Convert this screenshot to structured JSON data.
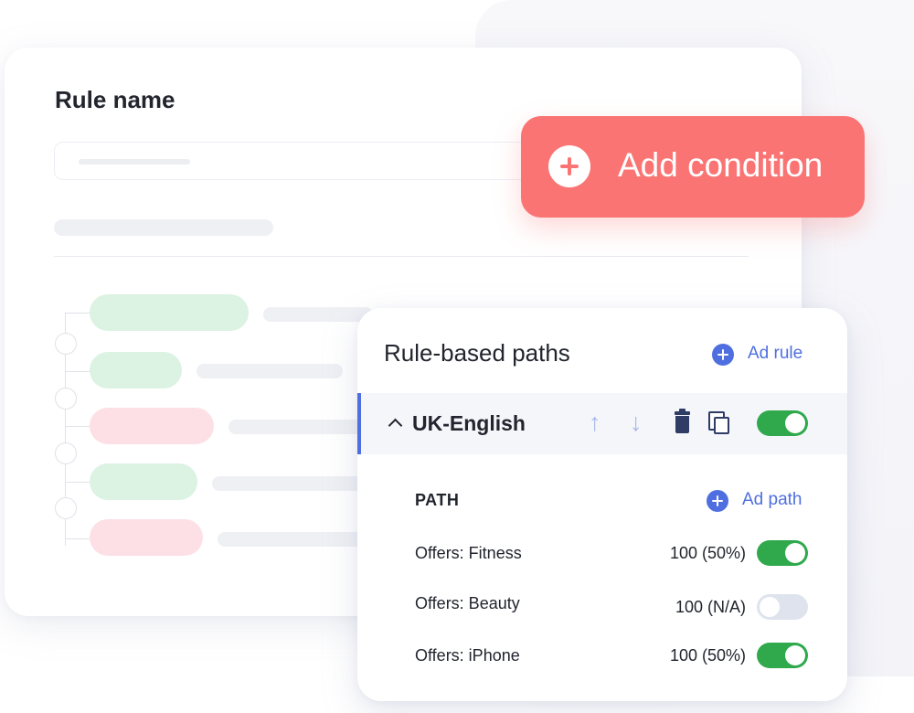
{
  "rule_form": {
    "title": "Rule name"
  },
  "add_condition": {
    "label": "Add condition",
    "accent": "#fb7474"
  },
  "paths_panel": {
    "title": "Rule-based paths",
    "add_rule_label": "Ad rule",
    "group": {
      "label": "UK-English",
      "enabled": true,
      "icons": [
        "arrow-up-icon",
        "arrow-down-icon",
        "trash-icon",
        "copy-icon"
      ]
    },
    "path_header": "PATH",
    "add_path_label": "Ad path",
    "paths": [
      {
        "name": "Offers: Fitness",
        "value": "100 (50%)",
        "enabled": true
      },
      {
        "name": "Offers: Beauty",
        "value": "100 (N/A)",
        "enabled": false
      },
      {
        "name": "Offers: iPhone",
        "value": "100 (50%)",
        "enabled": true
      }
    ],
    "accent": "#4f6fe0",
    "toggle_on_color": "#2fa94c"
  },
  "glyphs": {
    "arrow_up": "↑",
    "arrow_down": "↓"
  }
}
